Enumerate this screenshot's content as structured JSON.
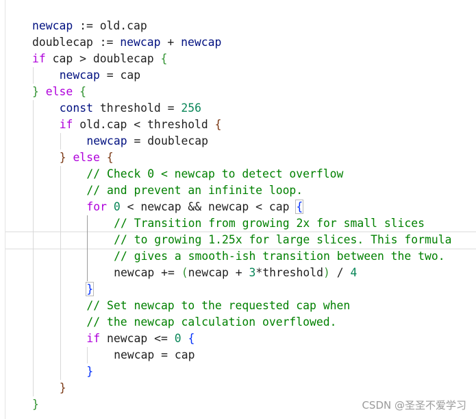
{
  "code_lines": [
    {
      "indent": 0,
      "tokens": [
        [
          "id",
          "newcap"
        ],
        [
          "tx",
          " := old.cap"
        ]
      ]
    },
    {
      "indent": 0,
      "tokens": [
        [
          "tx",
          "doublecap := "
        ],
        [
          "id",
          "newcap"
        ],
        [
          "tx",
          " + "
        ],
        [
          "id",
          "newcap"
        ]
      ]
    },
    {
      "indent": 0,
      "tokens": [
        [
          "kw",
          "if"
        ],
        [
          "tx",
          " cap > doublecap "
        ],
        [
          "b1",
          "{"
        ]
      ]
    },
    {
      "indent": 1,
      "tokens": [
        [
          "id",
          "newcap"
        ],
        [
          "tx",
          " = cap"
        ]
      ]
    },
    {
      "indent": 0,
      "tokens": [
        [
          "b1",
          "}"
        ],
        [
          "tx",
          " "
        ],
        [
          "kw",
          "else"
        ],
        [
          "tx",
          " "
        ],
        [
          "b1",
          "{"
        ]
      ]
    },
    {
      "indent": 1,
      "tokens": [
        [
          "id",
          "const"
        ],
        [
          "tx",
          " threshold = "
        ],
        [
          "num",
          "256"
        ]
      ]
    },
    {
      "indent": 1,
      "tokens": [
        [
          "kw",
          "if"
        ],
        [
          "tx",
          " old.cap < threshold "
        ],
        [
          "b2",
          "{"
        ]
      ]
    },
    {
      "indent": 2,
      "tokens": [
        [
          "id",
          "newcap"
        ],
        [
          "tx",
          " = doublecap"
        ]
      ]
    },
    {
      "indent": 1,
      "tokens": [
        [
          "b2",
          "}"
        ],
        [
          "tx",
          " "
        ],
        [
          "kw",
          "else"
        ],
        [
          "tx",
          " "
        ],
        [
          "b2",
          "{"
        ]
      ]
    },
    {
      "indent": 2,
      "tokens": [
        [
          "cm",
          "// Check 0 < newcap to detect overflow"
        ]
      ]
    },
    {
      "indent": 2,
      "tokens": [
        [
          "cm",
          "// and prevent an infinite loop."
        ]
      ]
    },
    {
      "indent": 2,
      "tokens": [
        [
          "kw",
          "for"
        ],
        [
          "tx",
          " "
        ],
        [
          "num",
          "0"
        ],
        [
          "tx",
          " < newcap && newcap < cap "
        ],
        [
          "b3 bx",
          "{"
        ]
      ]
    },
    {
      "indent": 3,
      "tokens": [
        [
          "cm",
          "// Transition from growing 2x for small slices"
        ]
      ]
    },
    {
      "indent": 3,
      "tokens": [
        [
          "cm",
          "// to growing 1.25x for large slices. This formula"
        ]
      ]
    },
    {
      "indent": 3,
      "tokens": [
        [
          "cm",
          "// gives a smooth-ish transition between the two."
        ]
      ]
    },
    {
      "indent": 3,
      "tokens": [
        [
          "tx",
          "newcap += "
        ],
        [
          "b1",
          "("
        ],
        [
          "tx",
          "newcap + "
        ],
        [
          "num",
          "3"
        ],
        [
          "tx",
          "*threshold"
        ],
        [
          "b1",
          ")"
        ],
        [
          "tx",
          " / "
        ],
        [
          "num",
          "4"
        ]
      ]
    },
    {
      "indent": 2,
      "tokens": [
        [
          "b3 bx",
          "}"
        ]
      ]
    },
    {
      "indent": 2,
      "tokens": [
        [
          "cm",
          "// Set newcap to the requested cap when"
        ]
      ]
    },
    {
      "indent": 2,
      "tokens": [
        [
          "cm",
          "// the newcap calculation overflowed."
        ]
      ]
    },
    {
      "indent": 2,
      "tokens": [
        [
          "kw",
          "if"
        ],
        [
          "tx",
          " newcap <= "
        ],
        [
          "num",
          "0"
        ],
        [
          "tx",
          " "
        ],
        [
          "b3",
          "{"
        ]
      ]
    },
    {
      "indent": 3,
      "tokens": [
        [
          "tx",
          "newcap = cap"
        ]
      ]
    },
    {
      "indent": 2,
      "tokens": [
        [
          "b3",
          "}"
        ]
      ]
    },
    {
      "indent": 1,
      "tokens": [
        [
          "b2",
          "}"
        ]
      ]
    },
    {
      "indent": 0,
      "tokens": [
        [
          "b1",
          "}"
        ]
      ]
    }
  ],
  "watermark": "CSDN @圣圣不爱学习"
}
